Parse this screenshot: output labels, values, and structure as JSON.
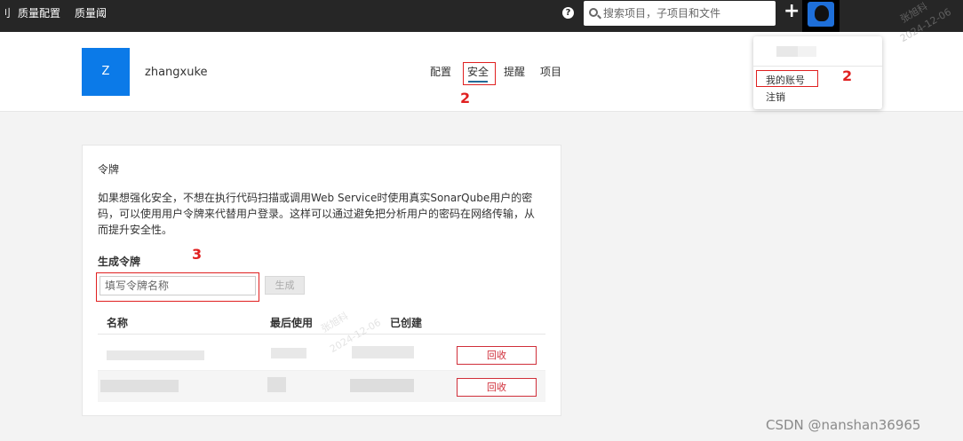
{
  "topbar": {
    "nav_items": [
      "刂",
      "质量配置",
      "质量阈"
    ],
    "help_icon": "question-circle-icon",
    "search": {
      "placeholder": "搜索项目，子项目和文件",
      "icon": "search-icon"
    },
    "plus_icon": "plus-icon",
    "avatar_icon": "user-avatar-icon",
    "background": "#262626"
  },
  "header": {
    "avatar_letter": "Z",
    "username": "zhangxuke",
    "tabs": [
      {
        "label": "配置",
        "active": false
      },
      {
        "label": "安全",
        "active": true
      },
      {
        "label": "提醒",
        "active": false
      },
      {
        "label": "项目",
        "active": false
      }
    ],
    "avatar_color": "#0b7ae8"
  },
  "dropdown": {
    "items": [
      "我的账号",
      "注销"
    ]
  },
  "annotations": {
    "tab_marker": "2",
    "dropdown_marker": "2",
    "generate_marker": "3"
  },
  "tokens": {
    "title": "令牌",
    "description": "如果想强化安全，不想在执行代码扫描或调用Web Service时使用真实SonarQube用户的密码，可以使用用户令牌来代替用户登录。这样可以通过避免把分析用户的密码在网络传输，从而提升安全性。",
    "generate_label": "生成令牌",
    "name_placeholder": "填写令牌名称",
    "generate_button": "生成",
    "columns": [
      "名称",
      "最后使用",
      "已创建"
    ],
    "rows": [
      {
        "revoke_label": "回收"
      },
      {
        "revoke_label": "回收"
      }
    ]
  },
  "watermark": {
    "author": "张旭科",
    "date": "2024-12-06",
    "footer": "CSDN @nanshan36965"
  },
  "colors": {
    "annotation_red": "#e02020",
    "revoke_red": "#d02f3a",
    "tab_underline": "#236a97"
  }
}
